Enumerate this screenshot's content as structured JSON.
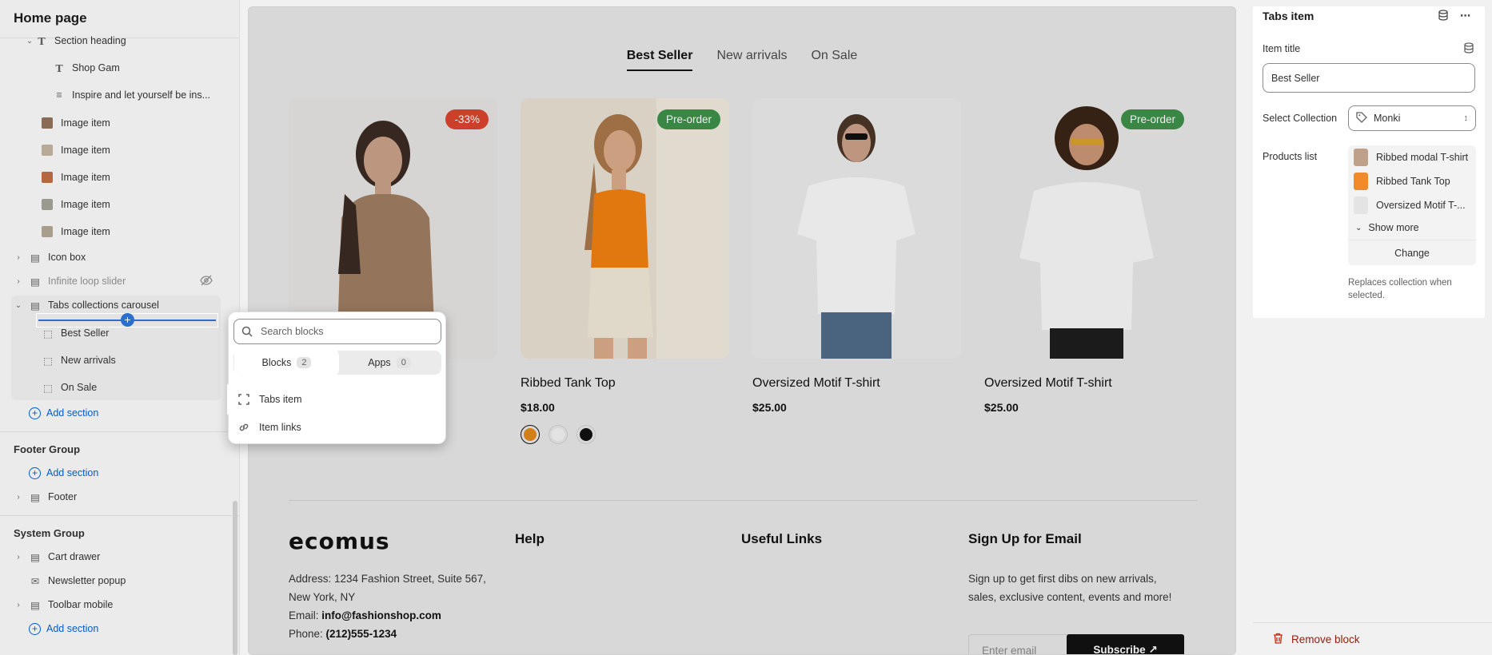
{
  "sidebar": {
    "title": "Home page",
    "items": [
      {
        "label": "Section heading"
      },
      {
        "label": "Shop Gam"
      },
      {
        "label": "Inspire and let yourself be ins..."
      },
      {
        "label": "Image item"
      },
      {
        "label": "Image item"
      },
      {
        "label": "Image item"
      },
      {
        "label": "Image item"
      },
      {
        "label": "Image item"
      },
      {
        "label": "Icon box"
      },
      {
        "label": "Infinite loop slider"
      },
      {
        "label": "Tabs collections carousel"
      },
      {
        "label": "Best Seller"
      },
      {
        "label": "New arrivals"
      },
      {
        "label": "On Sale"
      }
    ],
    "add_section_label": "Add section",
    "footer_group": {
      "title": "Footer Group",
      "items": [
        {
          "label": "Footer"
        }
      ]
    },
    "system_group": {
      "title": "System Group",
      "items": [
        {
          "label": "Cart drawer"
        },
        {
          "label": "Newsletter popup"
        },
        {
          "label": "Toolbar mobile"
        }
      ]
    }
  },
  "picker": {
    "search_placeholder": "Search blocks",
    "tabs": [
      {
        "label": "Blocks",
        "count": "2"
      },
      {
        "label": "Apps",
        "count": "0"
      }
    ],
    "items": [
      {
        "label": "Tabs item",
        "icon": "block-icon"
      },
      {
        "label": "Item links",
        "icon": "link-icon"
      }
    ]
  },
  "preview": {
    "tabs": [
      "Best Seller",
      "New arrivals",
      "On Sale"
    ],
    "active_tab": "Best Seller",
    "products": [
      {
        "name": "",
        "price": "",
        "badge": "-33%"
      },
      {
        "name": "Ribbed Tank Top",
        "price": "$18.00",
        "badge": "Pre-order"
      },
      {
        "name": "Oversized Motif T-shirt",
        "price": "$25.00",
        "badge": ""
      },
      {
        "name": "Oversized Motif T-shirt",
        "price": "$25.00",
        "badge": "Pre-order"
      }
    ],
    "swatch_colors": [
      "#e0861b",
      "#f2f2f2",
      "#111111"
    ],
    "footer": {
      "logo": "ecomus",
      "address_label": "Address: 1234 Fashion Street, Suite 567,",
      "address_line2": "New York, NY",
      "email_prefix": "Email: ",
      "email": "info@fashionshop.com",
      "phone_prefix": "Phone: ",
      "phone": "(212)555-1234",
      "help_title": "Help",
      "links_title": "Useful Links",
      "signup_title": "Sign Up for Email",
      "signup_text_1": "Sign up to get first dibs on new arrivals,",
      "signup_text_2": "sales, exclusive content, events and more!",
      "email_placeholder": "Enter email",
      "subscribe_label": "Subscribe ↗"
    }
  },
  "panel": {
    "title": "Tabs item",
    "item_title_label": "Item title",
    "item_title_value": "Best Seller",
    "collection_label": "Select Collection",
    "collection_value": "Monki",
    "products_label": "Products list",
    "products": [
      "Ribbed modal T-shirt",
      "Ribbed Tank Top",
      "Oversized Motif T-..."
    ],
    "show_more": "Show more",
    "change": "Change",
    "help": "Replaces collection when selected.",
    "remove": "Remove block"
  },
  "colors": {
    "accent": "#005bd3",
    "sale_badge": "#d9442e",
    "preorder_badge": "#3e8f4a",
    "remove": "#8e1f0b"
  }
}
